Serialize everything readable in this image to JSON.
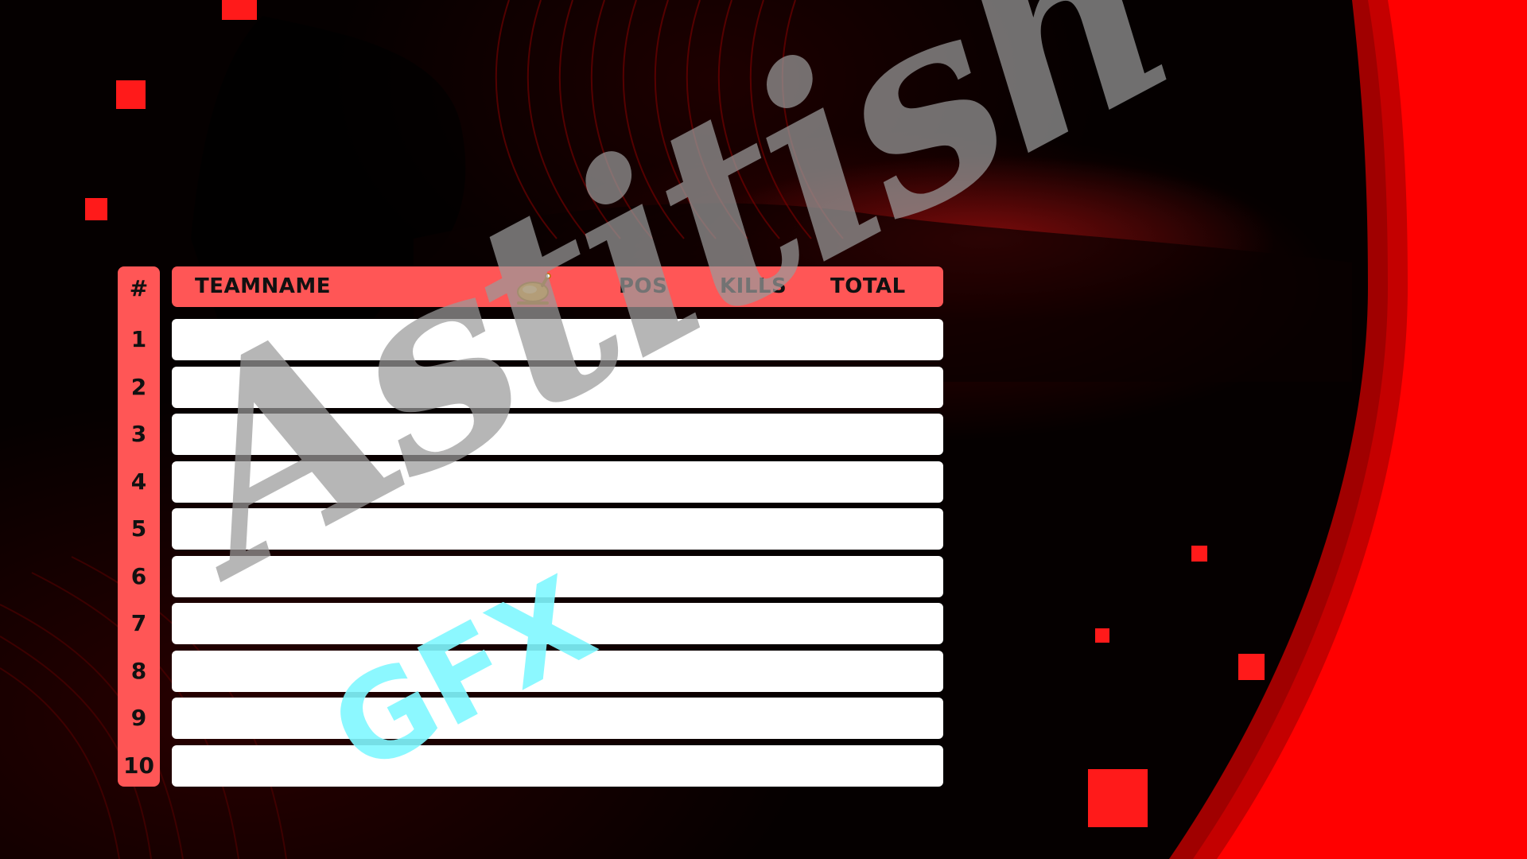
{
  "scoreboard": {
    "hash_label": "#",
    "headers": {
      "teamname": "TEAMNAME",
      "chicken_icon": "chicken-dinner-icon",
      "pos": "POS",
      "kills": "KILLS",
      "total": "TOTAL"
    },
    "ranks": [
      "1",
      "2",
      "3",
      "4",
      "5",
      "6",
      "7",
      "8",
      "9",
      "10"
    ]
  },
  "watermark": {
    "script_text": "Astitish",
    "gfx_text": "GFX"
  },
  "colors": {
    "accent": "#ff5656",
    "background": "#050000",
    "bright_red": "#ff0000",
    "row_fill": "#ffffff",
    "watermark_gray": "#9a9a9a",
    "gfx_cyan": "#7ff7ff"
  }
}
